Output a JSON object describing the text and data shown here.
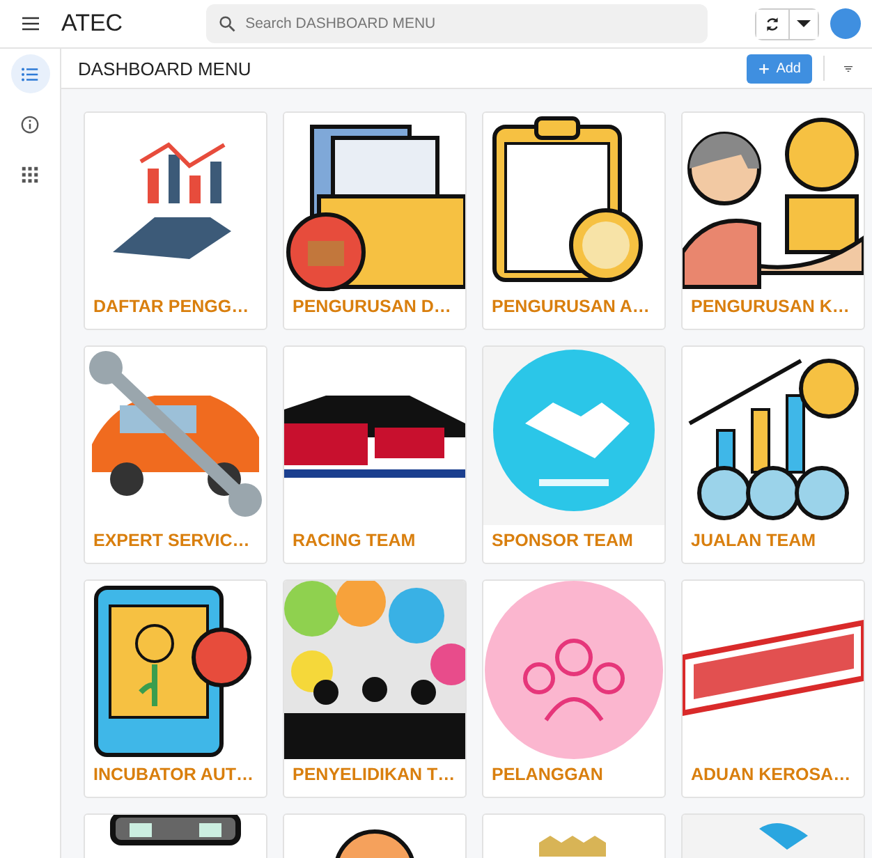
{
  "app": {
    "title": "ATEC"
  },
  "search": {
    "placeholder": "Search DASHBOARD MENU"
  },
  "rail": [
    {
      "kind": "list",
      "selected": true
    },
    {
      "kind": "info",
      "selected": false
    },
    {
      "kind": "grid",
      "selected": false
    }
  ],
  "page": {
    "title": "DASHBOARD MENU",
    "add_button": "Add"
  },
  "cards": [
    {
      "kind": "tile",
      "label": "DAFTAR PENGG…"
    },
    {
      "kind": "tile",
      "label": "PENGURUSAN D…"
    },
    {
      "kind": "tile",
      "label": "PENGURUSAN A…"
    },
    {
      "kind": "tile",
      "label": "PENGURUSAN K…"
    },
    {
      "kind": "tile",
      "label": "EXPERT SERVIC…"
    },
    {
      "kind": "tile",
      "label": "RACING TEAM"
    },
    {
      "kind": "tile",
      "label": "SPONSOR TEAM"
    },
    {
      "kind": "tile",
      "label": "JUALAN TEAM"
    },
    {
      "kind": "tile",
      "label": "INCUBATOR AUT…"
    },
    {
      "kind": "tile",
      "label": "PENYELIDIKAN T…"
    },
    {
      "kind": "tile",
      "label": "PELANGGAN"
    },
    {
      "kind": "tile",
      "label": "ADUAN KEROSA…"
    },
    {
      "kind": "picture"
    },
    {
      "kind": "picture"
    },
    {
      "kind": "picture"
    },
    {
      "kind": "picture"
    }
  ]
}
